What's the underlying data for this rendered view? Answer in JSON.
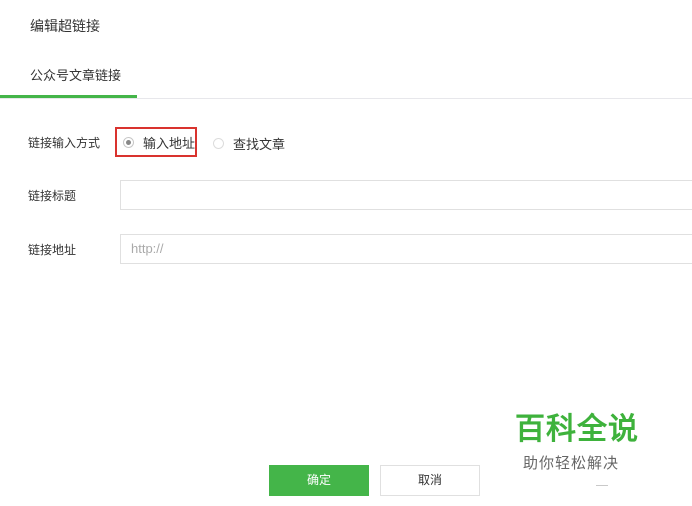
{
  "dialog": {
    "title": "编辑超链接"
  },
  "tabs": [
    {
      "label": "公众号文章链接",
      "active": true
    }
  ],
  "form": {
    "input_method_label": "链接输入方式",
    "radio_options": [
      {
        "label": "输入地址",
        "selected": true
      },
      {
        "label": "查找文章",
        "selected": false
      }
    ],
    "link_title_label": "链接标题",
    "link_title_value": "",
    "link_url_label": "链接地址",
    "link_url_placeholder": "http://"
  },
  "buttons": {
    "confirm": "确定",
    "cancel": "取消"
  },
  "watermark": {
    "title": "百科全说",
    "subtitle": "助你轻松解决"
  },
  "colors": {
    "accent": "#44b549",
    "highlight_border": "#d9332e",
    "watermark_green": "#3eb23c"
  }
}
